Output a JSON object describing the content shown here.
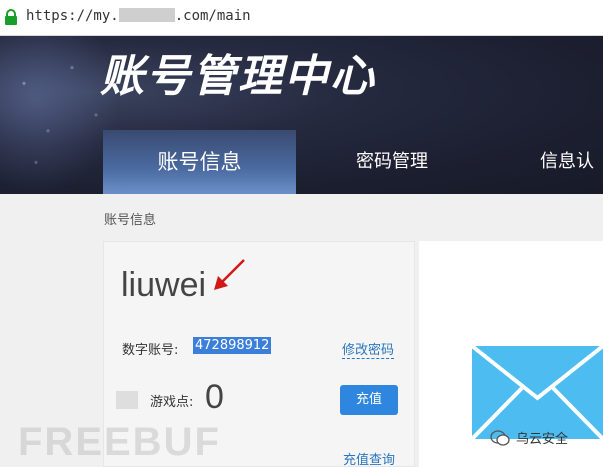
{
  "browser": {
    "url_prefix": "https://my.",
    "url_suffix": ".com/main"
  },
  "header": {
    "title": "账号管理中心",
    "tabs": [
      {
        "label": "账号信息",
        "active": true
      },
      {
        "label": "密码管理",
        "active": false
      },
      {
        "label": "信息认",
        "active": false
      }
    ]
  },
  "breadcrumb": "账号信息",
  "account": {
    "username": "liuwei",
    "number_label": "数字账号:",
    "number_value": "472898912",
    "change_password_link": "修改密码",
    "game_points_label": "游戏点:",
    "game_points_value": "0",
    "recharge_button": "充值",
    "recharge_query_link": "充值查询"
  },
  "watermark": "FREEBUF",
  "wechat_account": "乌云安全",
  "colors": {
    "accent_blue": "#2f86de",
    "link_blue": "#2a75c0",
    "envelope_blue": "#4dbcf0",
    "annotation_red": "#d01818"
  },
  "icons": [
    "lock-icon",
    "annotation-arrow-icon",
    "envelope-icon",
    "wechat-icon"
  ]
}
